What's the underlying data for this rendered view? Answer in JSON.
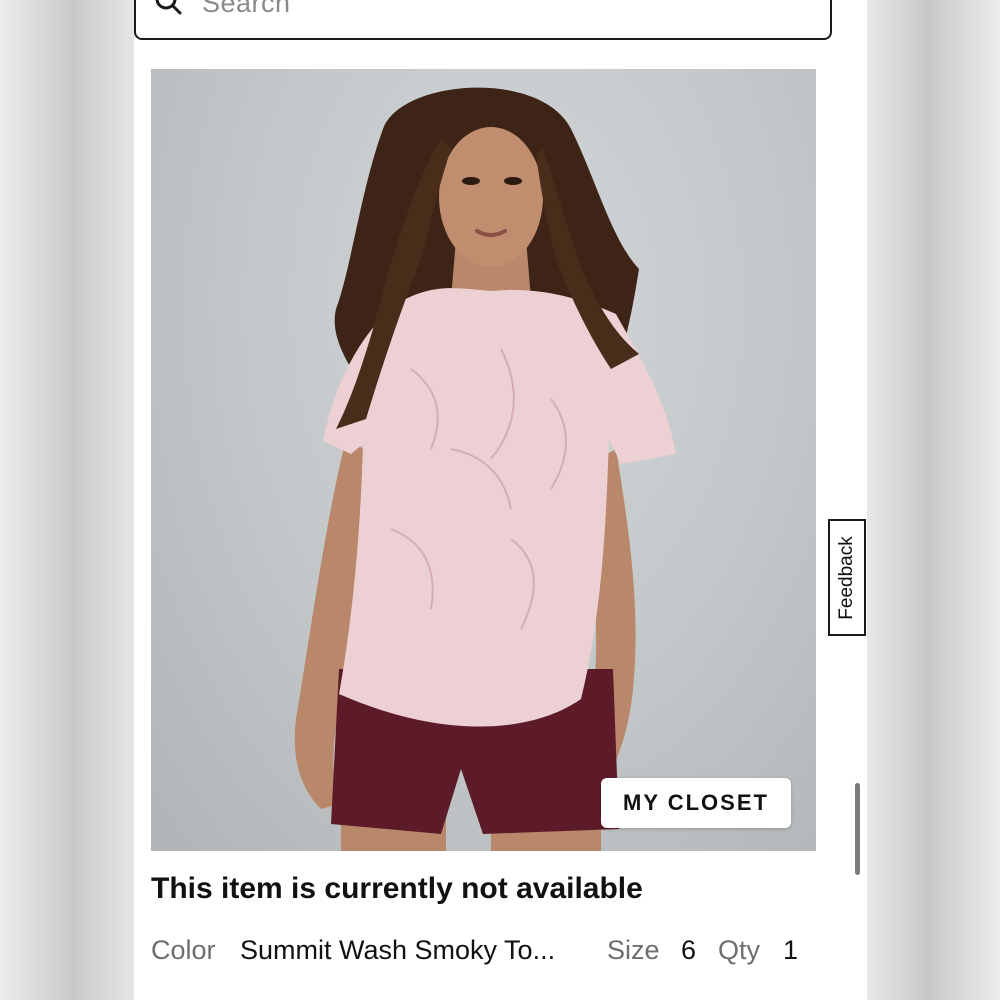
{
  "search": {
    "placeholder": "Search"
  },
  "product": {
    "image_description_icon": "model-photo",
    "closet_button_label": "MY CLOSET",
    "status": "This item is currently not available",
    "color_label": "Color",
    "color_value": "Summit Wash Smoky To...",
    "size_label": "Size",
    "size_value": "6",
    "qty_label": "Qty",
    "qty_value": "1"
  },
  "feedback": {
    "label": "Feedback"
  },
  "colors": {
    "shirt": "#ecd0d3",
    "shorts": "#5d1b2a",
    "hair": "#3d2416",
    "skin": "#b9876a",
    "backdrop": "#c3c6c8"
  }
}
